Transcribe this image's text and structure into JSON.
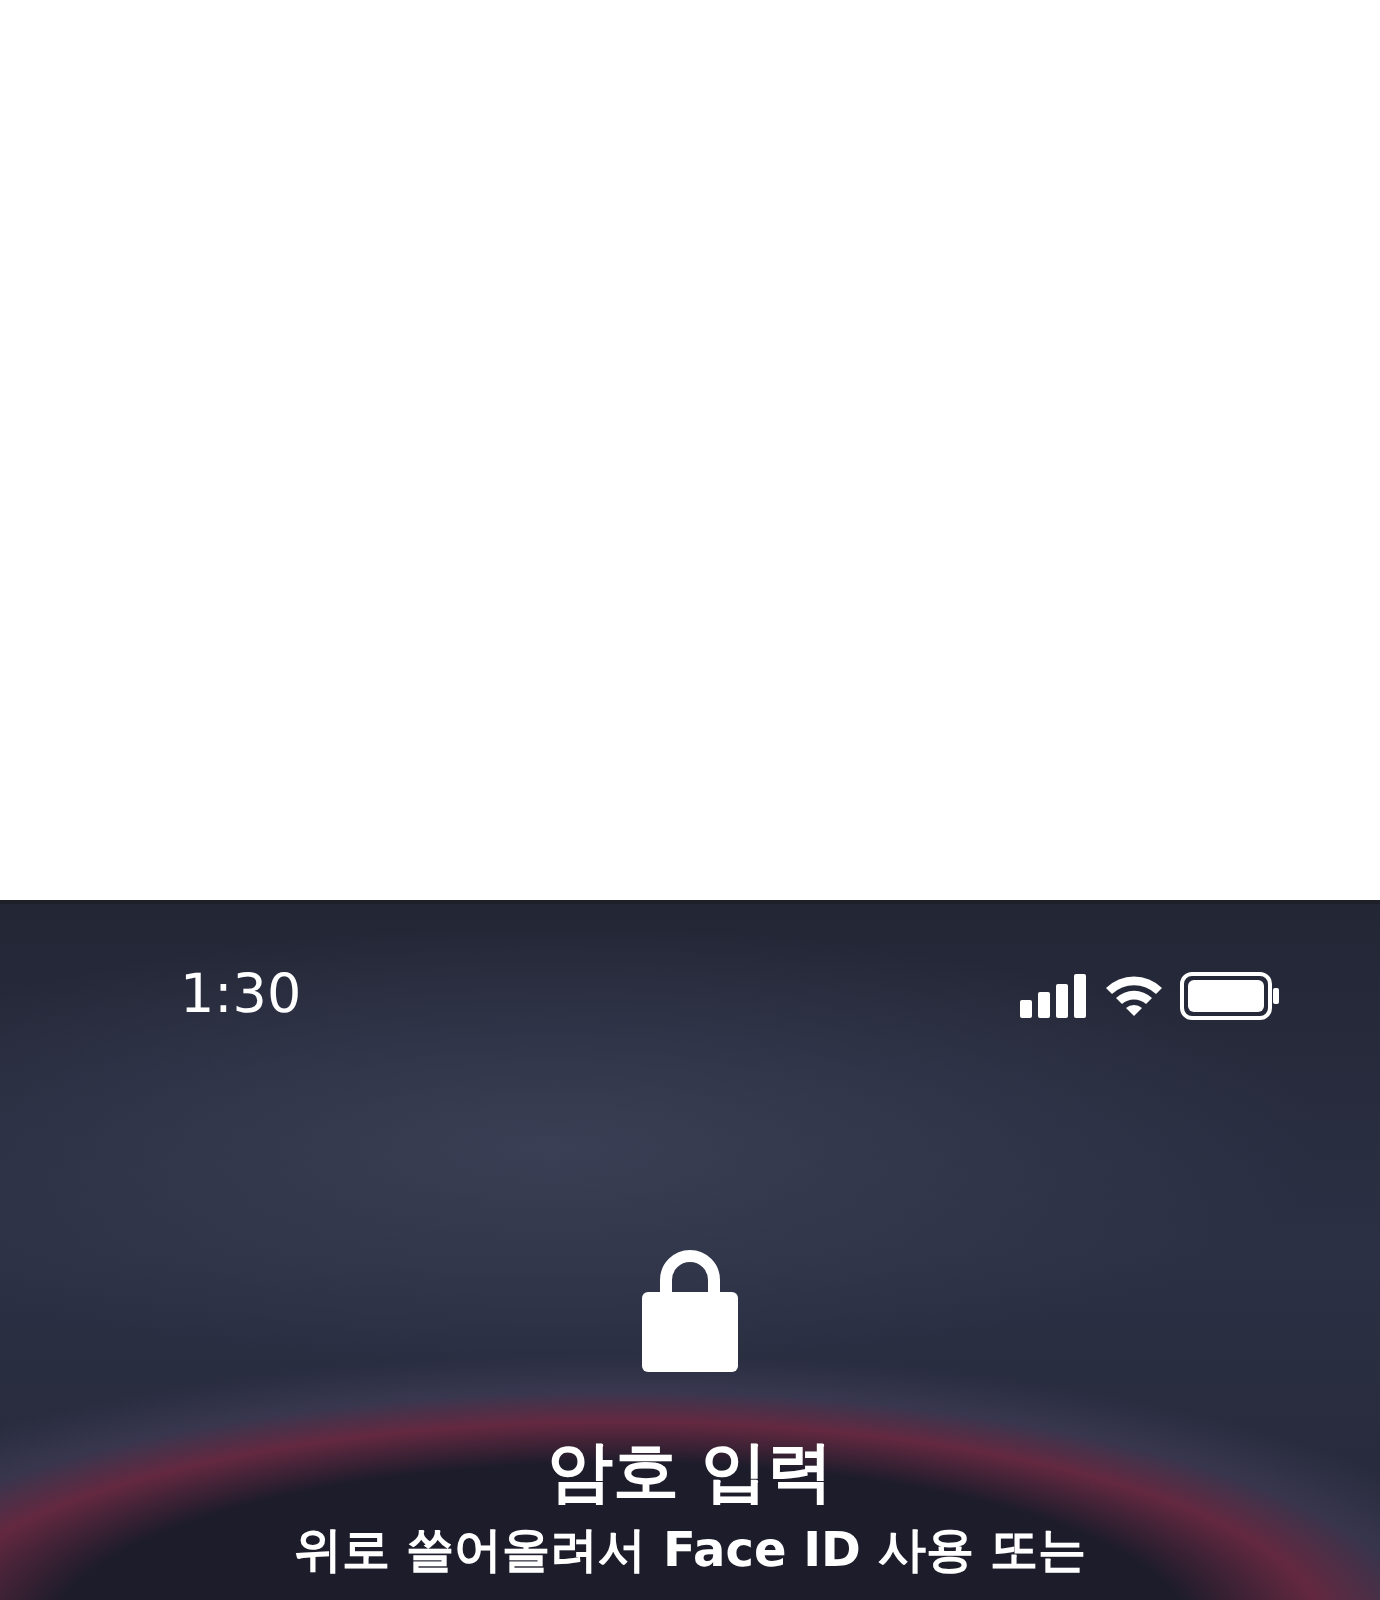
{
  "status_bar": {
    "time": "1:30"
  },
  "lock_screen": {
    "title": "암호 입력",
    "subtitle": "위로 쓸어올려서 Face ID 사용 또는"
  }
}
